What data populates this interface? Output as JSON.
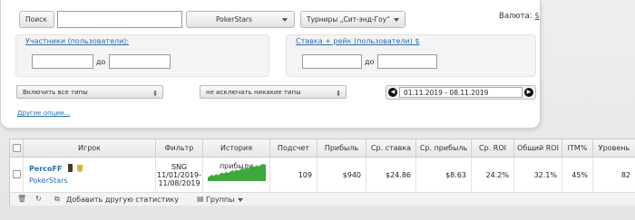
{
  "filters": {
    "search_button": "Поиск",
    "search_value": "",
    "site_select": "PokerStars",
    "tournament_type": "Турниры „Сит-энд-Гоу“",
    "currency_label": "Валюта:",
    "currency_symbol": "$",
    "participants_link": "Участники (пользователи):",
    "participants_from": "",
    "participants_to_label": "до",
    "participants_to": "",
    "stake_link": "Ставка + рейк (пользователи)",
    "stake_currency": "$",
    "stake_from": "",
    "stake_to_label": "до",
    "stake_to": "",
    "include_types": "Включить все типы",
    "exclude_types": "не исключать никакие типы",
    "date_range": "01.11.2019 - 08.11.2019",
    "other_options": "Другие опции..."
  },
  "table": {
    "headers": [
      "Игрок",
      "Фильтр",
      "История прибыли",
      "Подсчет",
      "Прибыль",
      "Ср. ставка",
      "Ср. прибыль",
      "Ср. ROI",
      "Общий ROI",
      "ITM%",
      "Уровень"
    ],
    "row": {
      "player": "PercoFF",
      "site": "PokerStars",
      "filter_line1": "SNG",
      "filter_line2": "11/01/2019-",
      "filter_line3": "11/08/2019",
      "count": "109",
      "profit": "$940",
      "avg_stake": "$24.86",
      "avg_profit": "$8.63",
      "avg_roi": "24.2%",
      "total_roi": "32.1%",
      "itm": "45%",
      "level": "82"
    },
    "footer": {
      "add_label": "Добавить другую статистику",
      "groups_label": "Группы"
    }
  },
  "colors": {
    "link": "#2b6cb0",
    "sparkline": "#3fa83c"
  }
}
